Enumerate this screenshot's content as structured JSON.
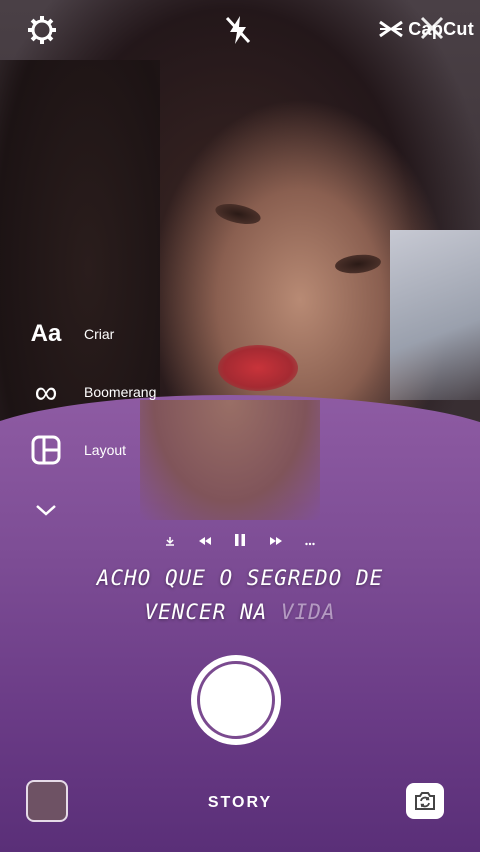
{
  "app": {
    "watermark": "CapCut",
    "mode": "STORY"
  },
  "icons": {
    "settings": "gear-icon",
    "flash": "flash-off-icon",
    "close": "close-icon",
    "expand": "chevron-down-icon",
    "flip": "flip-camera-icon"
  },
  "tools": [
    {
      "label": "Criar",
      "icon": "text-create-icon",
      "glyph": "Aa"
    },
    {
      "label": "Boomerang",
      "icon": "infinity-icon",
      "glyph": "∞"
    },
    {
      "label": "Layout",
      "icon": "layout-icon",
      "glyph": ""
    }
  ],
  "music": {
    "buttons": [
      "download",
      "previous",
      "pause",
      "next",
      "more"
    ]
  },
  "lyrics": {
    "line1": "ACHO QUE O SEGREDO DE",
    "line2a": "VENCER NA ",
    "line2b": "VIDA"
  },
  "colors": {
    "shirt": "#7d4d95",
    "shutter_ring": "#7a4a8f"
  }
}
